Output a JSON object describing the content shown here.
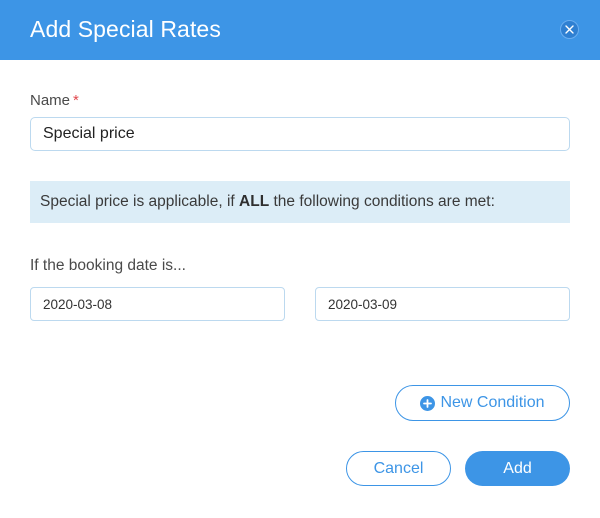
{
  "dialog": {
    "title": "Add Special Rates",
    "close_icon": "close-icon"
  },
  "name_field": {
    "label": "Name",
    "required_mark": "*",
    "value": "Special price"
  },
  "info_banner": {
    "text_before": "Special price is applicable, if ",
    "emphasis": "ALL",
    "text_after": " the following conditions are met:"
  },
  "booking_date": {
    "label": "If the booking date is...",
    "from_value": "2020-03-08",
    "to_value": "2020-03-09"
  },
  "actions": {
    "new_condition_label": "New Condition",
    "new_condition_icon": "plus-circle-icon",
    "cancel_label": "Cancel",
    "add_label": "Add"
  },
  "colors": {
    "primary": "#3d95e6",
    "info_background": "#dcedf7",
    "required": "#e0474c"
  }
}
